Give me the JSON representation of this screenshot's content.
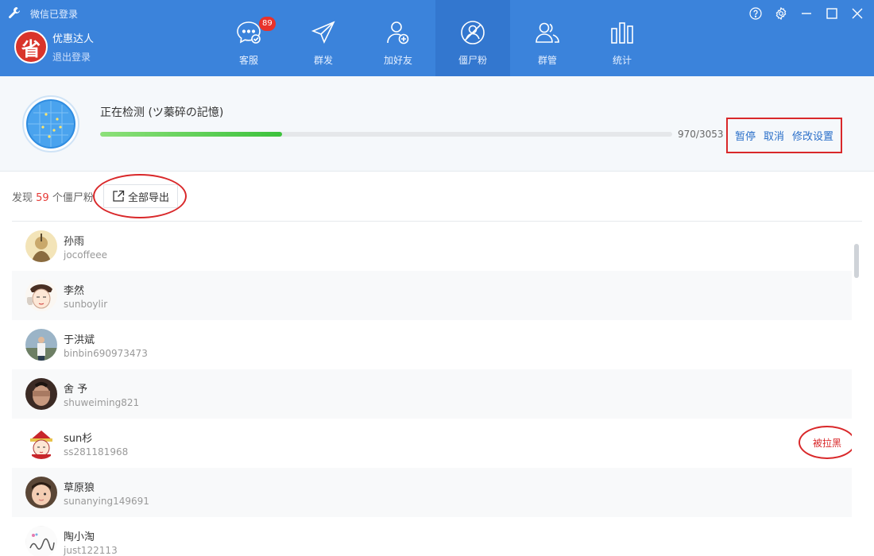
{
  "titlebar": {
    "status_label": "微信已登录"
  },
  "user": {
    "avatar_char": "省",
    "name": "优惠达人",
    "logout_label": "退出登录"
  },
  "nav": {
    "items": [
      {
        "label": "客服",
        "icon": "chat-icon",
        "badge": "89"
      },
      {
        "label": "群发",
        "icon": "send-icon"
      },
      {
        "label": "加好友",
        "icon": "add-friend-icon"
      },
      {
        "label": "僵尸粉",
        "icon": "zombie-fan-icon",
        "active": true
      },
      {
        "label": "群管",
        "icon": "group-manage-icon"
      },
      {
        "label": "统计",
        "icon": "stats-icon"
      }
    ]
  },
  "colors": {
    "header": "#3b83db",
    "accent_red": "#d9282a",
    "progress": "#3cc23c",
    "link": "#2a6fc9"
  },
  "detect": {
    "title": "正在检测 (ツ蓁碎の記憶)",
    "progress_text": "970/3053",
    "progress_fraction": 0.318,
    "pause_label": "暂停",
    "cancel_label": "取消",
    "settings_label": "修改设置"
  },
  "found": {
    "prefix": "发现",
    "count": "59",
    "suffix": "个僵尸粉",
    "export_label": "全部导出"
  },
  "contacts": [
    {
      "name": "孙雨",
      "id": "jocoffeee"
    },
    {
      "name": "李然",
      "id": "sunboylir"
    },
    {
      "name": "于洪斌",
      "id": "binbin690973473"
    },
    {
      "name": "舍 予",
      "id": "shuweiming821"
    },
    {
      "name": "sun杉",
      "id": "ss281181968",
      "status": "被拉黑"
    },
    {
      "name": "草原狼",
      "id": "sunanying149691"
    },
    {
      "name": "陶小淘",
      "id": "just122113"
    }
  ]
}
